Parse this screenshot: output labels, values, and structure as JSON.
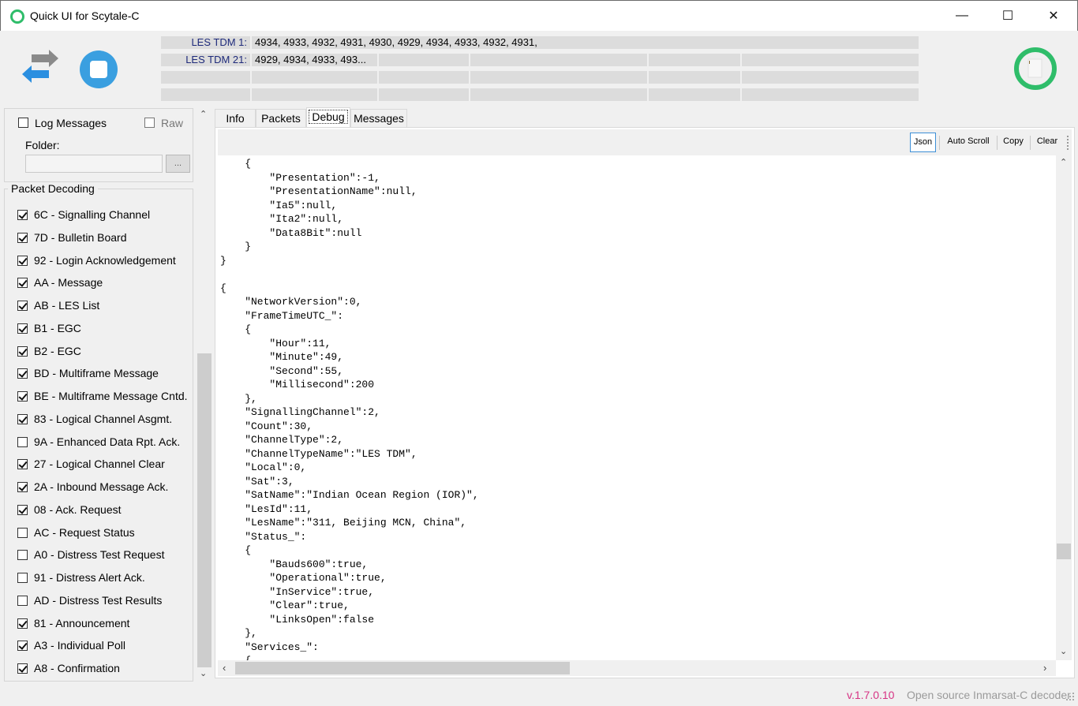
{
  "window": {
    "title": "Quick UI for Scytale-C",
    "minimize_icon": "minimize-icon",
    "maximize_icon": "maximize-icon",
    "close_icon": "close-icon",
    "minimize_glyph": "—",
    "maximize_glyph": "☐",
    "close_glyph": "✕"
  },
  "toolbar": {
    "switch_icon": "swap-arrows-icon",
    "stop_icon": "stop-icon",
    "status_indicator_icon": "status-ring-icon",
    "tdm_rows": [
      {
        "label": "LES TDM 1:",
        "value": "4934, 4933, 4932, 4931, 4930, 4929, 4934, 4933, 4932, 4931,"
      },
      {
        "label": "LES TDM 21:",
        "value": "4929, 4934, 4933, 493..."
      }
    ]
  },
  "left_panel": {
    "log_messages_label": "Log Messages",
    "log_messages_checked": false,
    "raw_label": "Raw",
    "raw_checked": false,
    "folder_label": "Folder:",
    "folder_value": "",
    "browse_label": "...",
    "packet_decoding_title": "Packet Decoding",
    "packets": [
      {
        "label": "6C - Signalling Channel",
        "checked": true
      },
      {
        "label": "7D - Bulletin Board",
        "checked": true
      },
      {
        "label": "92 - Login Acknowledgement",
        "checked": true
      },
      {
        "label": "AA - Message",
        "checked": true
      },
      {
        "label": "AB - LES List",
        "checked": true
      },
      {
        "label": "B1 - EGC",
        "checked": true
      },
      {
        "label": "B2 - EGC",
        "checked": true
      },
      {
        "label": "BD - Multiframe Message",
        "checked": true
      },
      {
        "label": "BE - Multiframe Message Cntd.",
        "checked": true
      },
      {
        "label": "83 - Logical Channel Asgmt.",
        "checked": true
      },
      {
        "label": "9A - Enhanced Data Rpt. Ack.",
        "checked": false
      },
      {
        "label": "27 - Logical Channel Clear",
        "checked": true
      },
      {
        "label": "2A - Inbound Message Ack.",
        "checked": true
      },
      {
        "label": "08 - Ack. Request",
        "checked": true
      },
      {
        "label": "AC - Request Status",
        "checked": false
      },
      {
        "label": "A0 - Distress Test Request",
        "checked": false
      },
      {
        "label": "91 - Distress Alert Ack.",
        "checked": false
      },
      {
        "label": "AD - Distress Test Results",
        "checked": false
      },
      {
        "label": "81 - Announcement",
        "checked": true
      },
      {
        "label": "A3 - Individual Poll",
        "checked": true
      },
      {
        "label": "A8 - Confirmation",
        "checked": true
      }
    ]
  },
  "tabs": [
    {
      "label": "Info",
      "active": false
    },
    {
      "label": "Packets",
      "active": false
    },
    {
      "label": "Debug",
      "active": true
    },
    {
      "label": "Messages",
      "active": false
    }
  ],
  "debug_toolbar": {
    "json_label": "Json",
    "autoscroll_label": "Auto Scroll",
    "copy_label": "Copy",
    "clear_label": "Clear"
  },
  "debug_output": "    {\n        \"Presentation\":-1,\n        \"PresentationName\":null,\n        \"Ia5\":null,\n        \"Ita2\":null,\n        \"Data8Bit\":null\n    }\n}\n\n{\n    \"NetworkVersion\":0,\n    \"FrameTimeUTC_\":\n    {\n        \"Hour\":11,\n        \"Minute\":49,\n        \"Second\":55,\n        \"Millisecond\":200\n    },\n    \"SignallingChannel\":2,\n    \"Count\":30,\n    \"ChannelType\":2,\n    \"ChannelTypeName\":\"LES TDM\",\n    \"Local\":0,\n    \"Sat\":3,\n    \"SatName\":\"Indian Ocean Region (IOR)\",\n    \"LesId\":11,\n    \"LesName\":\"311, Beijing MCN, China\",\n    \"Status_\":\n    {\n        \"Bauds600\":true,\n        \"Operational\":true,\n        \"InService\":true,\n        \"Clear\":true,\n        \"LinksOpen\":false\n    },\n    \"Services_\":\n    {",
  "status_bar": {
    "version": "v.1.7.0.10",
    "description": "Open source Inmarsat-C decoder"
  },
  "colors": {
    "accent": "#2fbd6a",
    "stop_button": "#3a9fe0",
    "version_text": "#d63384",
    "tdm_label": "#1e2a7a"
  }
}
